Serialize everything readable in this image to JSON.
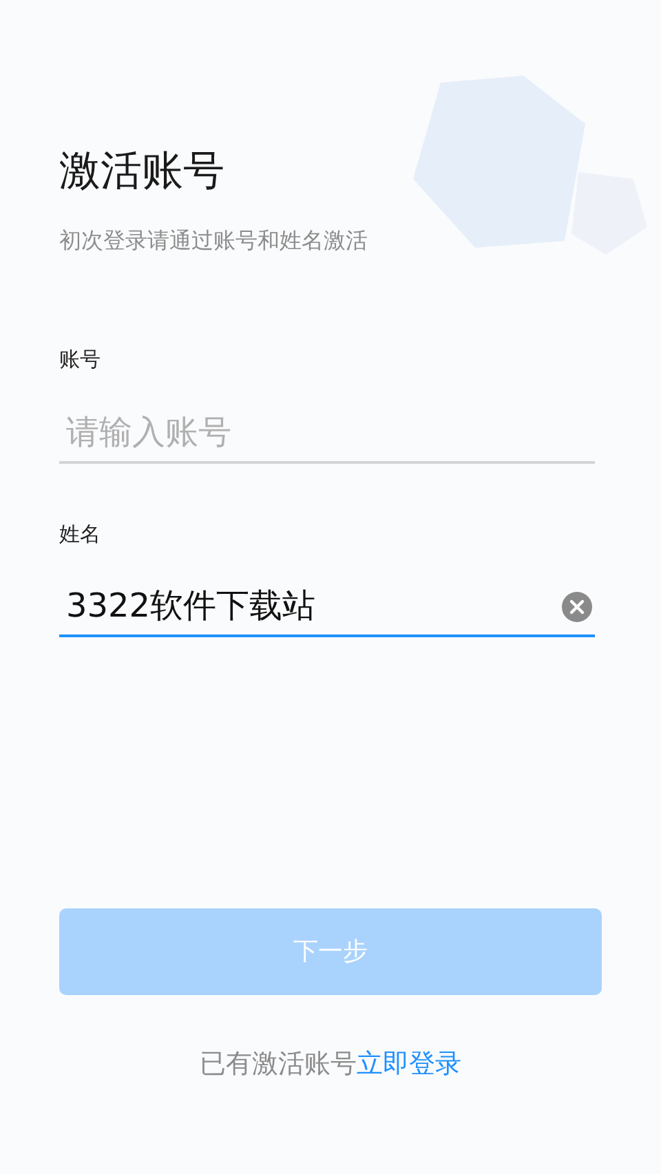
{
  "title": "激活账号",
  "subtitle": "初次登录请通过账号和姓名激活",
  "fields": [
    {
      "label": "账号",
      "placeholder": "请输入账号",
      "focused": false
    },
    {
      "label": "姓名",
      "value": "3322软件下载站",
      "focused": true
    }
  ],
  "next_button": {
    "label": "下一步",
    "disabled": true
  },
  "footer": {
    "text": "已有激活账号",
    "link": "立即登录"
  }
}
